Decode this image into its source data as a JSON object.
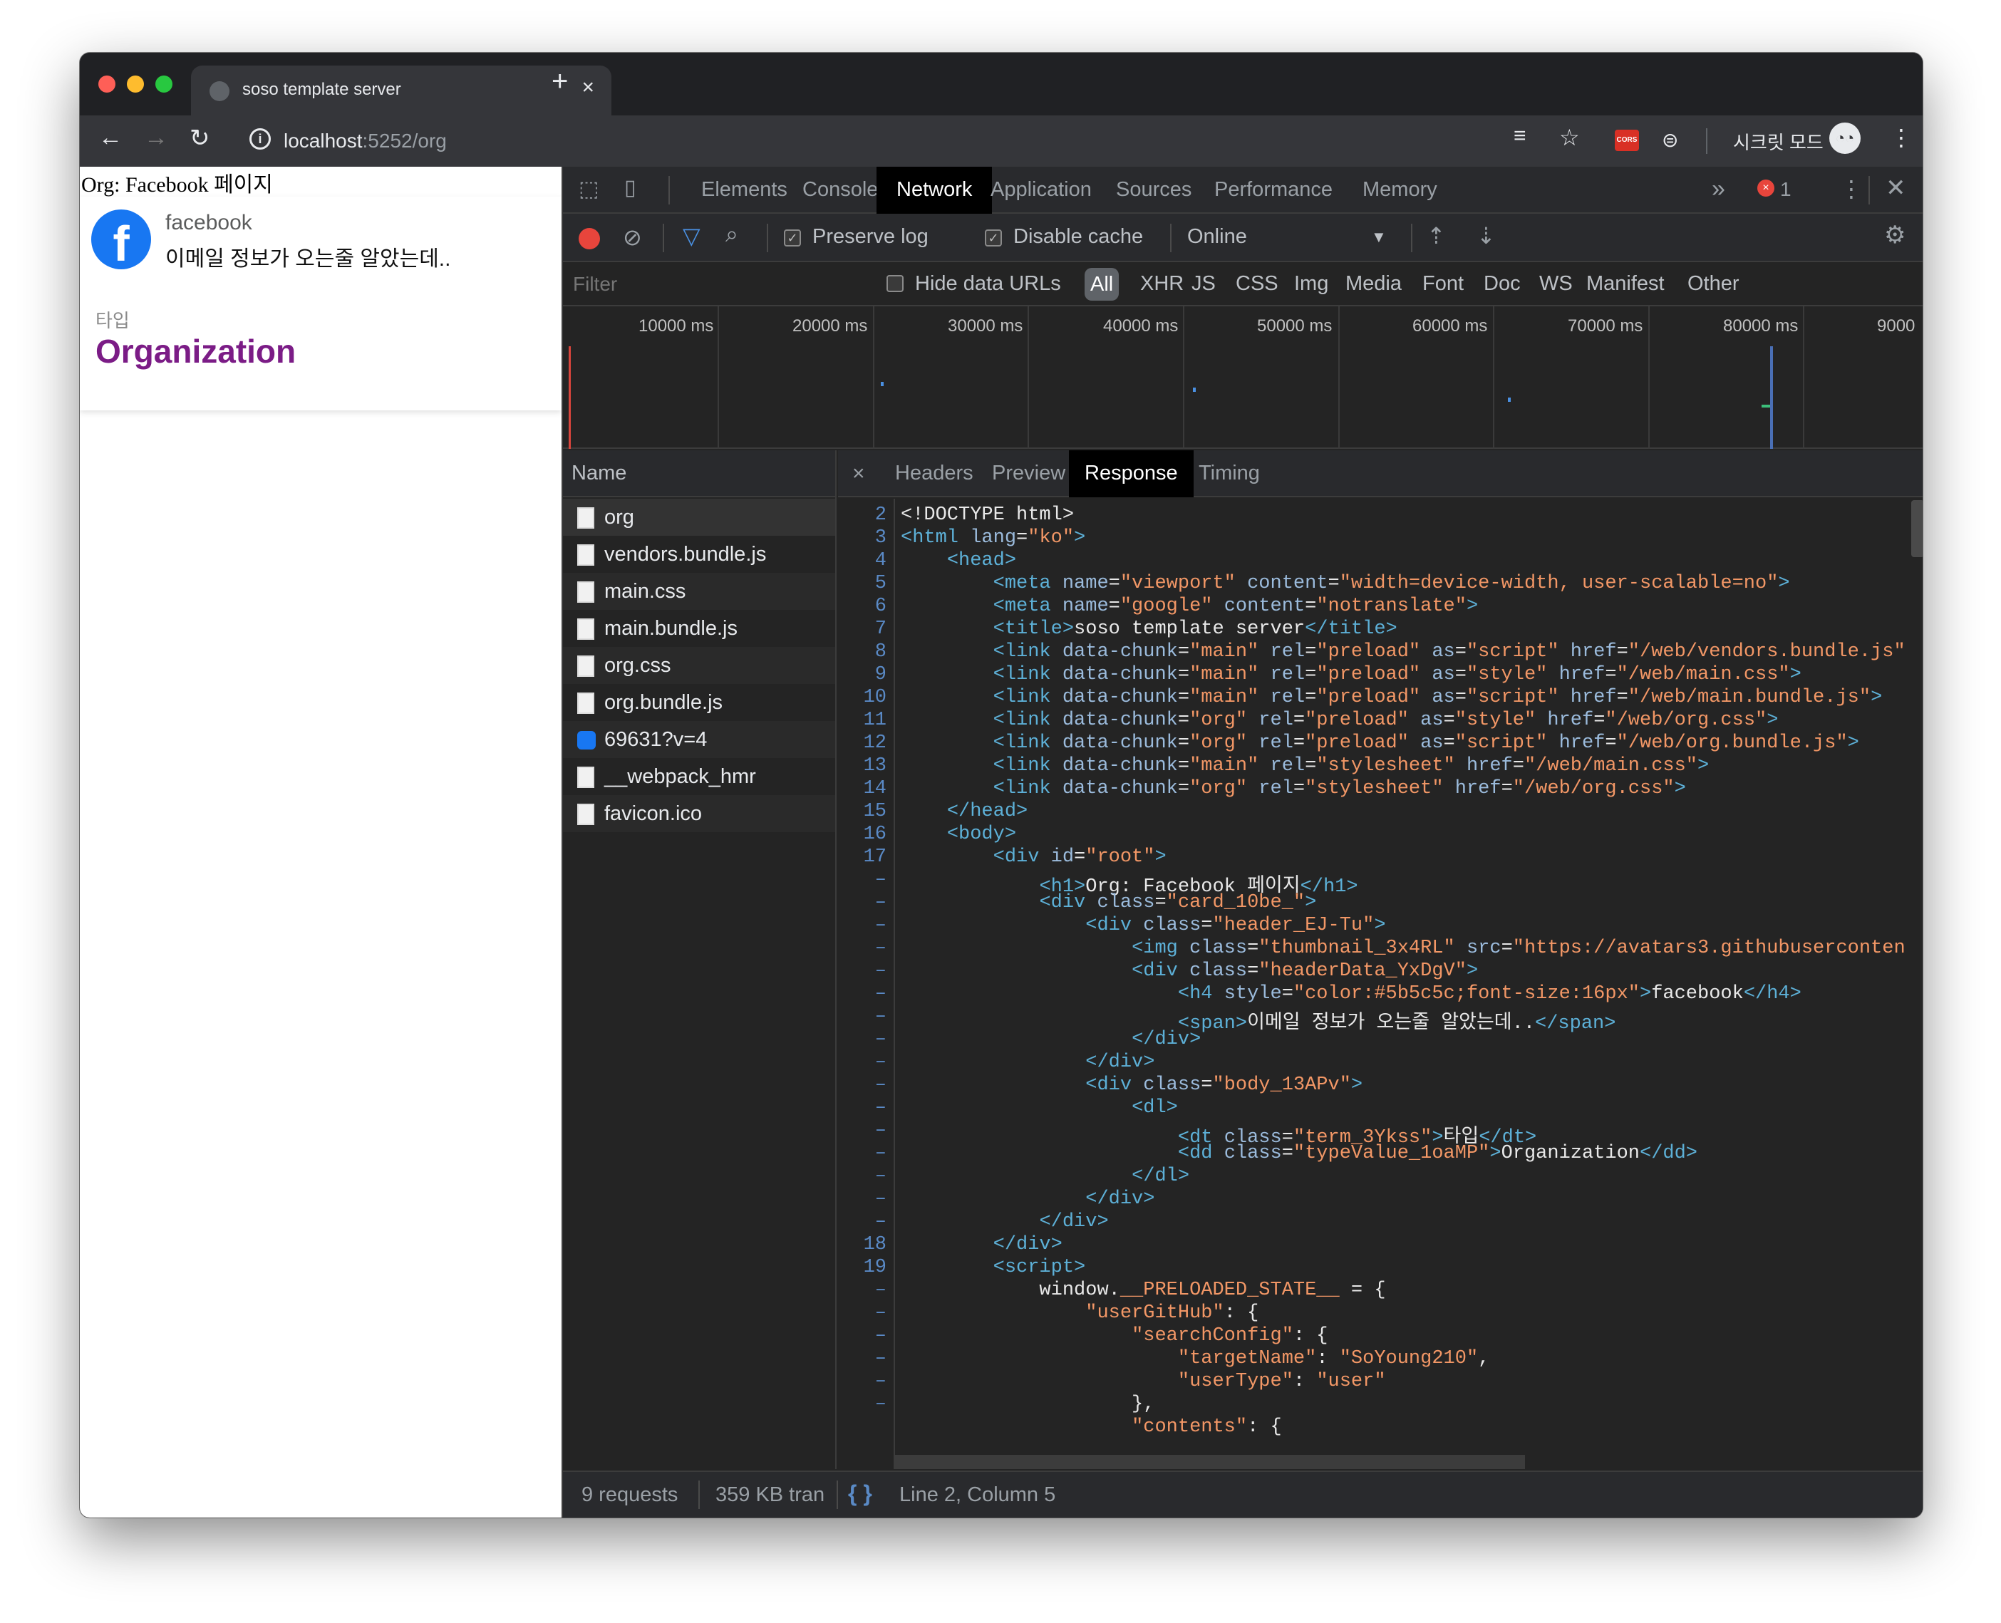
{
  "browser": {
    "tab_title": "soso template server",
    "url_host": "localhost",
    "url_path": ":5252/org",
    "incognito_label": "시크릿 모드",
    "extension_badge": "CORS"
  },
  "page": {
    "heading": "Org: Facebook 페이지",
    "card": {
      "name": "facebook",
      "description": "이메일 정보가 오는줄 알았는데..",
      "term": "타입",
      "value": "Organization"
    }
  },
  "devtools": {
    "tabs": [
      "Elements",
      "Console",
      "Network",
      "Application",
      "Sources",
      "Performance",
      "Memory"
    ],
    "active_tab": "Network",
    "more": "»",
    "error_count": "1",
    "toolbar": {
      "preserve_log": "Preserve log",
      "disable_cache": "Disable cache",
      "throttle": "Online"
    },
    "filter": {
      "placeholder": "Filter",
      "hide_data_urls": "Hide data URLs",
      "types": [
        "All",
        "XHR",
        "JS",
        "CSS",
        "Img",
        "Media",
        "Font",
        "Doc",
        "WS",
        "Manifest",
        "Other"
      ]
    },
    "timeline_labels": [
      "10000 ms",
      "20000 ms",
      "30000 ms",
      "40000 ms",
      "50000 ms",
      "60000 ms",
      "70000 ms",
      "80000 ms",
      "9000"
    ],
    "name_header": "Name",
    "requests": [
      "org",
      "vendors.bundle.js",
      "main.css",
      "main.bundle.js",
      "org.css",
      "org.bundle.js",
      "69631?v=4",
      "__webpack_hmr",
      "favicon.ico"
    ],
    "response_tabs": [
      "Headers",
      "Preview",
      "Response",
      "Timing"
    ],
    "active_response_tab": "Response",
    "status": {
      "requests": "9 requests",
      "transferred": "359 KB tran",
      "position": "Line 2, Column 5"
    }
  }
}
